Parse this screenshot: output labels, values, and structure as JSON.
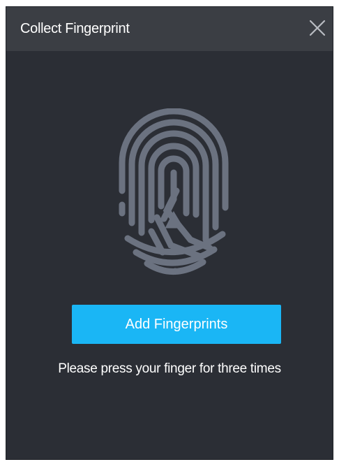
{
  "dialog": {
    "title": "Collect Fingerprint",
    "close_icon": "close-icon",
    "fingerprint_icon": "fingerprint-icon",
    "add_button_label": "Add Fingerprints",
    "hint_text": "Please press your finger for three times"
  },
  "colors": {
    "background": "#2b2e35",
    "title_bar": "#3b3e44",
    "accent": "#1ab6f5",
    "icon": "#6b7280",
    "text": "#ffffff"
  }
}
